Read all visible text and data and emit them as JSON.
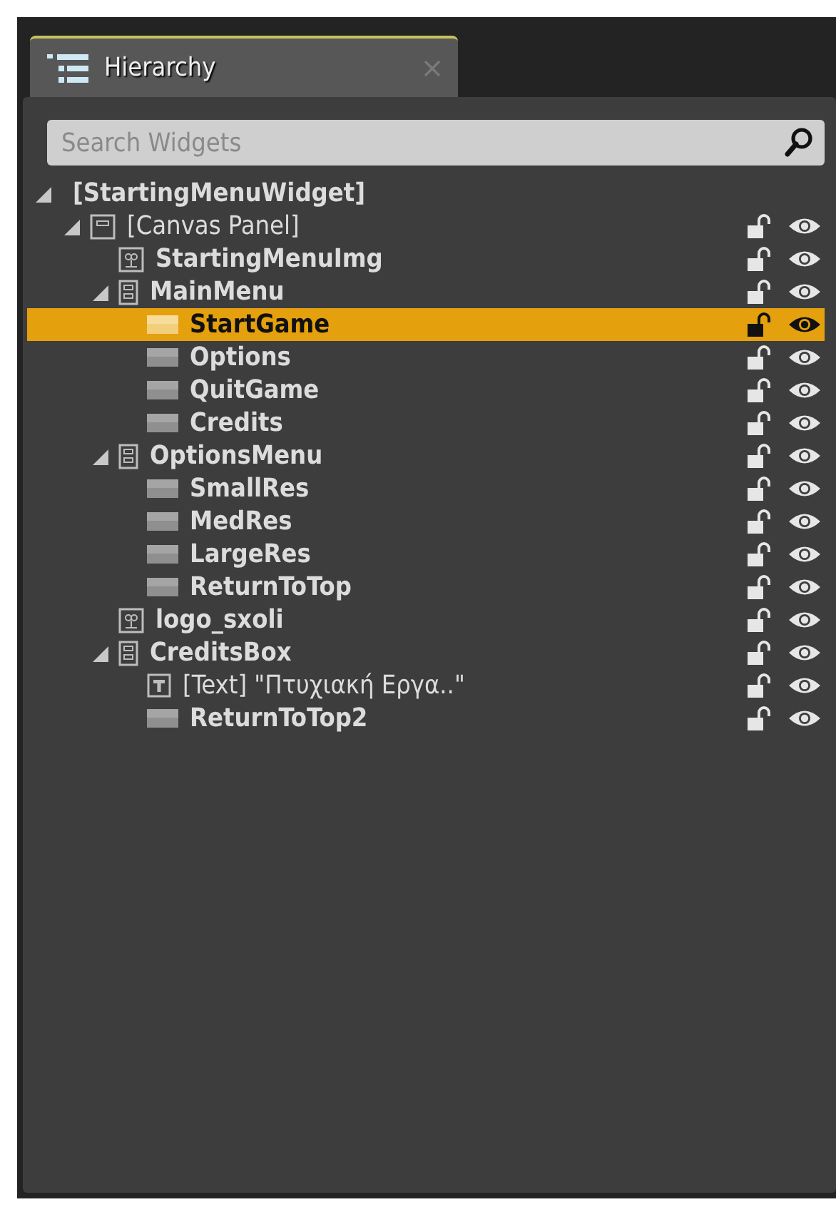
{
  "tab": {
    "title": "Hierarchy"
  },
  "search": {
    "placeholder": "Search Widgets"
  },
  "tree": [
    {
      "label": "[StartingMenuWidget]",
      "kind": "root",
      "selected": false,
      "expanded": true,
      "children": [
        {
          "label": "[Canvas Panel]",
          "kind": "canvas",
          "selected": false,
          "expanded": true,
          "children": [
            {
              "label": "StartingMenuImg",
              "kind": "image",
              "selected": false
            },
            {
              "label": "MainMenu",
              "kind": "vbox",
              "selected": false,
              "expanded": true,
              "children": [
                {
                  "label": "StartGame",
                  "kind": "button",
                  "selected": true
                },
                {
                  "label": "Options",
                  "kind": "button",
                  "selected": false
                },
                {
                  "label": "QuitGame",
                  "kind": "button",
                  "selected": false
                },
                {
                  "label": "Credits",
                  "kind": "button",
                  "selected": false
                }
              ]
            },
            {
              "label": "OptionsMenu",
              "kind": "vbox",
              "selected": false,
              "expanded": true,
              "children": [
                {
                  "label": "SmallRes",
                  "kind": "button",
                  "selected": false
                },
                {
                  "label": "MedRes",
                  "kind": "button",
                  "selected": false
                },
                {
                  "label": "LargeRes",
                  "kind": "button",
                  "selected": false
                },
                {
                  "label": "ReturnToTop",
                  "kind": "button",
                  "selected": false
                }
              ]
            },
            {
              "label": "logo_sxoli",
              "kind": "image",
              "selected": false
            },
            {
              "label": "CreditsBox",
              "kind": "vbox",
              "selected": false,
              "expanded": true,
              "children": [
                {
                  "label": "[Text] \"Πτυχιακή Εργα..\"",
                  "kind": "text",
                  "selected": false
                },
                {
                  "label": "ReturnToTop2",
                  "kind": "button",
                  "selected": false
                }
              ]
            }
          ]
        }
      ]
    }
  ]
}
